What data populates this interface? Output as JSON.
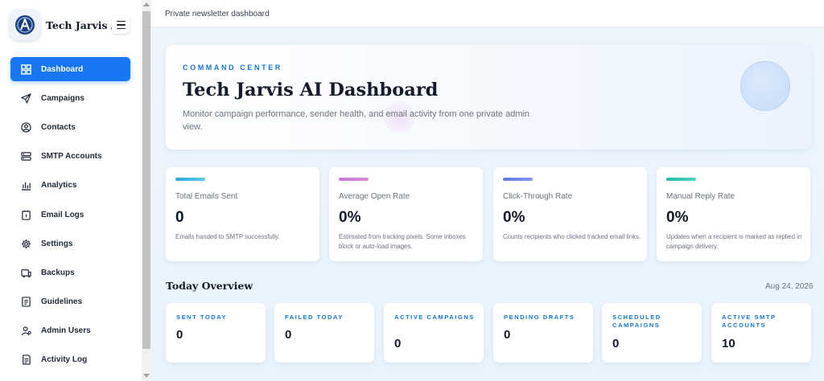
{
  "brand": {
    "name": "Tech Jarvis AI",
    "logo_icon": "ai-logo-icon"
  },
  "sidebar": {
    "items": [
      {
        "label": "Dashboard",
        "icon": "grid-icon",
        "active": true
      },
      {
        "label": "Campaigns",
        "icon": "send-icon"
      },
      {
        "label": "Contacts",
        "icon": "user-circle-icon"
      },
      {
        "label": "SMTP Accounts",
        "icon": "server-icon"
      },
      {
        "label": "Analytics",
        "icon": "analytics-icon"
      },
      {
        "label": "Email Logs",
        "icon": "log-icon"
      },
      {
        "label": "Settings",
        "icon": "gear-icon"
      },
      {
        "label": "Backups",
        "icon": "backup-icon"
      },
      {
        "label": "Guidelines",
        "icon": "document-icon"
      },
      {
        "label": "Admin Users",
        "icon": "admin-user-icon"
      },
      {
        "label": "Activity Log",
        "icon": "activity-icon"
      }
    ]
  },
  "topbar": {
    "title": "Private newsletter dashboard"
  },
  "hero": {
    "eyebrow": "COMMAND CENTER",
    "title": "Tech Jarvis AI Dashboard",
    "description": "Monitor campaign performance, sender health, and email activity from one private admin view."
  },
  "stats": [
    {
      "label": "Total Emails Sent",
      "value": "0",
      "note": "Emails handed to SMTP successfully.",
      "accent": "#2fa6e0"
    },
    {
      "label": "Average Open Rate",
      "value": "0%",
      "note": "Estimated from tracking pixels. Some inboxes block or auto-load images.",
      "accent": "#c276df"
    },
    {
      "label": "Click-Through Rate",
      "value": "0%",
      "note": "Counts recipients who clicked tracked email links.",
      "accent": "#5b7be6"
    },
    {
      "label": "Manual Reply Rate",
      "value": "0%",
      "note": "Updates when a recipient is marked as replied in campaign delivery.",
      "accent": "#22bcae"
    }
  ],
  "overview": {
    "title": "Today Overview",
    "date": "Aug 24, 2026",
    "cards": [
      {
        "label": "SENT TODAY",
        "value": "0"
      },
      {
        "label": "FAILED TODAY",
        "value": "0"
      },
      {
        "label": "ACTIVE CAMPAIGNS",
        "value": "0"
      },
      {
        "label": "PENDING DRAFTS",
        "value": "0"
      },
      {
        "label": "SCHEDULED CAMPAIGNS",
        "value": "0"
      },
      {
        "label": "ACTIVE SMTP ACCOUNTS",
        "value": "10"
      }
    ]
  },
  "colors": {
    "accent": "#1877f2",
    "eyebrow": "#1677d2"
  }
}
